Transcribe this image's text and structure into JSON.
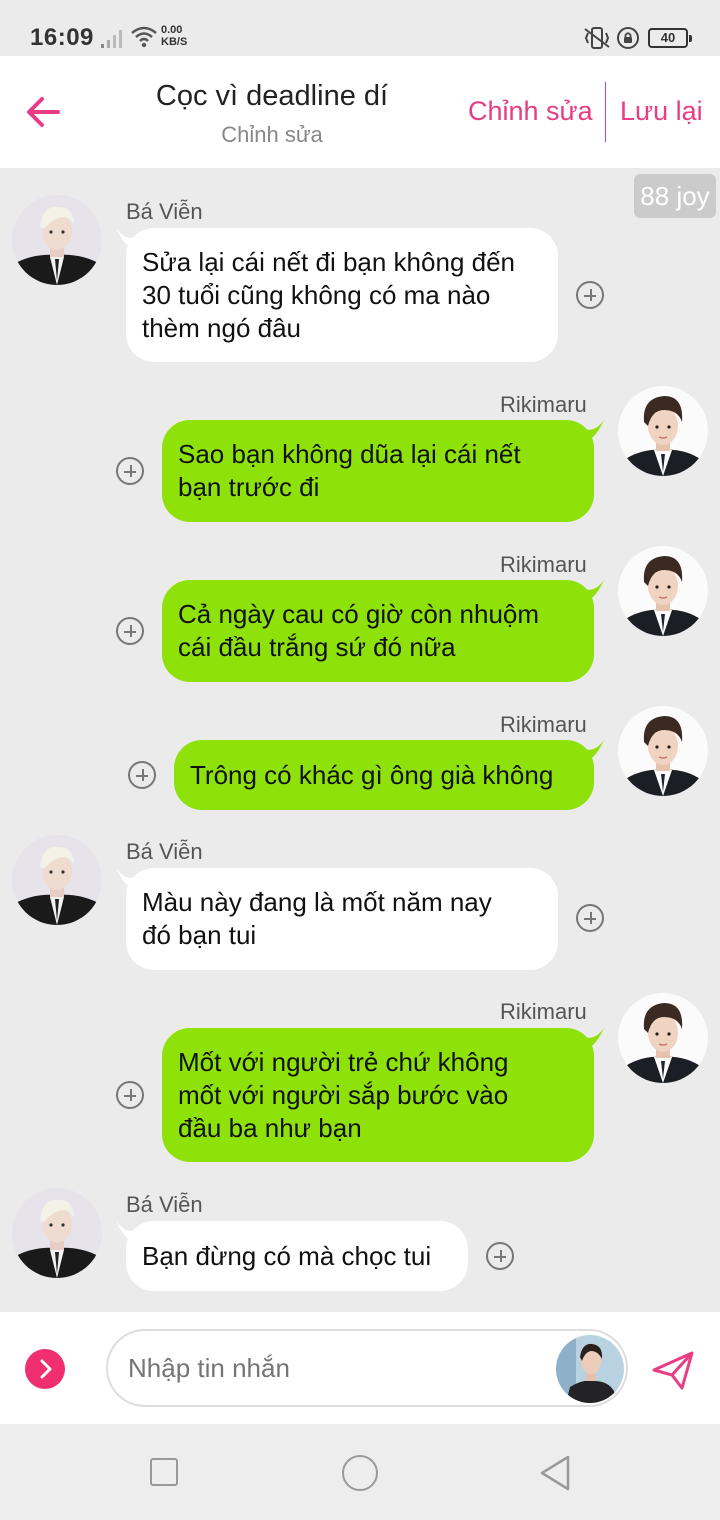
{
  "status_bar": {
    "time": "16:09",
    "net_speed_value": "0.00",
    "net_speed_unit": "KB/S",
    "battery": "40",
    "icons": [
      "signal-icon",
      "wifi-icon",
      "vibrate-icon",
      "lock-rotation-icon",
      "battery-icon"
    ]
  },
  "header": {
    "title": "Cọc vì deadline dí",
    "subtitle": "Chỉnh sửa",
    "edit_label": "Chỉnh sửa",
    "save_label": "Lưu lại",
    "accent_color": "#e83c83"
  },
  "watermark": "88 joy",
  "messages": [
    {
      "sender": "Bá Viễn",
      "side": "left",
      "lines": [
        "Sửa lại cái nết đi bạn không đến",
        "30 tuổi cũng không có ma nào",
        "thèm ngó đâu"
      ]
    },
    {
      "sender": "Rikimaru",
      "side": "right",
      "lines": [
        "Sao bạn không dũa lại cái nết",
        "bạn trước đi"
      ]
    },
    {
      "sender": "Rikimaru",
      "side": "right",
      "lines": [
        "Cả ngày cau có giờ còn nhuộm",
        "cái đầu trắng sứ đó nữa"
      ]
    },
    {
      "sender": "Rikimaru",
      "side": "right",
      "lines": [
        "Trông có khác gì ông già không"
      ]
    },
    {
      "sender": "Bá Viễn",
      "side": "left",
      "lines": [
        "Màu này đang là mốt năm nay",
        "đó bạn tui"
      ]
    },
    {
      "sender": "Rikimaru",
      "side": "right",
      "lines": [
        "Mốt với người trẻ chứ không",
        "mốt với người sắp bước vào",
        "đầu ba như bạn"
      ]
    },
    {
      "sender": "Bá Viễn",
      "side": "left",
      "lines": [
        "Bạn đừng có mà chọc tui"
      ]
    }
  ],
  "composer": {
    "placeholder": "Nhập tin nhắn"
  },
  "colors": {
    "right_bubble": "#8ee20a",
    "left_bubble": "#ffffff",
    "background": "#ebebeb"
  }
}
